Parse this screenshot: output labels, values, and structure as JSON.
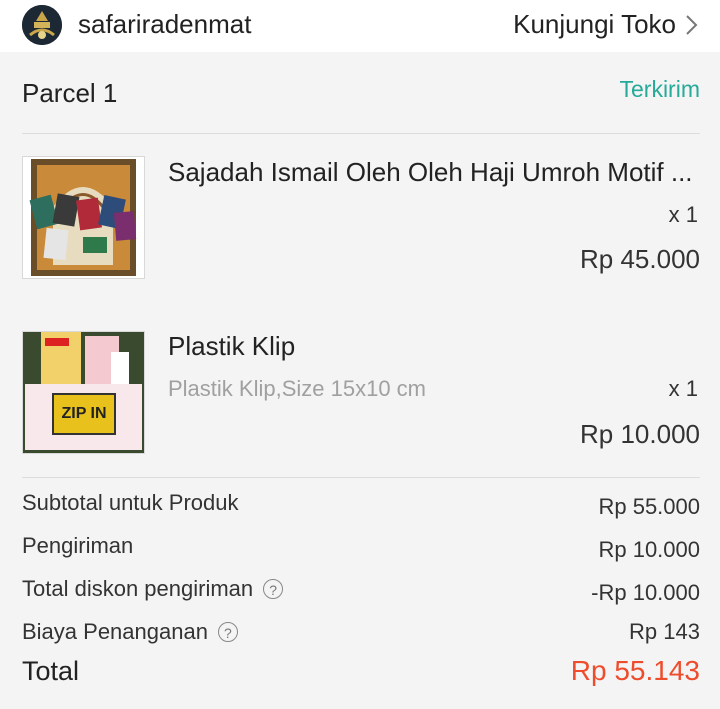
{
  "shop": {
    "name": "safariradenmat",
    "visit_label": "Kunjungi Toko"
  },
  "parcel": {
    "title": "Parcel 1",
    "status": "Terkirim"
  },
  "items": [
    {
      "name": "Sajadah Ismail Oleh Oleh Haji Umroh Motif ...",
      "variation": "",
      "qty": "x 1",
      "price": "Rp 45.000"
    },
    {
      "name": "Plastik Klip",
      "variation": "Plastik Klip,Size 15x10 cm",
      "qty": "x 1",
      "price": "Rp 10.000",
      "thumb_text": "ZIP IN"
    }
  ],
  "summary": {
    "subtotal_label": "Subtotal untuk Produk",
    "subtotal_value": "Rp 55.000",
    "shipping_label": "Pengiriman",
    "shipping_value": "Rp 10.000",
    "shipping_discount_label": "Total diskon pengiriman",
    "shipping_discount_value": "-Rp 10.000",
    "handling_label": "Biaya Penanganan",
    "handling_value": "Rp 143",
    "total_label": "Total",
    "total_value": "Rp 55.143",
    "help_icon_glyph": "?"
  },
  "colors": {
    "status": "#26aa99",
    "total": "#ee4d2d"
  }
}
